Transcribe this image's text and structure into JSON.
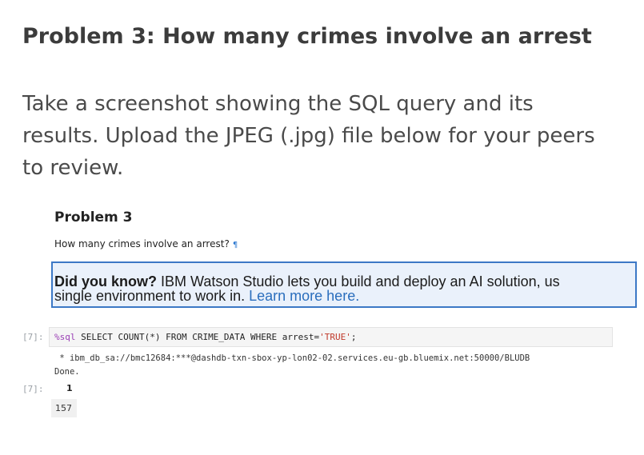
{
  "title": "Problem 3: How many crimes involve an arrest",
  "description": "Take a screenshot showing the SQL query and its results. Upload the JPEG (.jpg) file below for your peers to review.",
  "notebook": {
    "heading": "Problem 3",
    "question": "How many crimes involve an arrest?",
    "pilcrow": "¶",
    "callout": {
      "bold": "Did you know?",
      "text1": " IBM Watson Studio lets you build and deploy an AI solution, us",
      "text2": "single environment to work in. ",
      "link": "Learn more here."
    },
    "cell": {
      "in_prompt": "[7]:",
      "magic": "%sql",
      "query_start": " SELECT COUNT(*) FROM CRIME_DATA WHERE arrest=",
      "query_string": "'TRUE'",
      "query_end": ";",
      "connection": " * ibm_db_sa://bmc12684:***@dashdb-txn-sbox-yp-lon02-02.services.eu-gb.bluemix.net:50000/BLUDB",
      "status": "Done.",
      "out_prompt": "[7]:",
      "column_header": "1",
      "result": "157"
    }
  }
}
